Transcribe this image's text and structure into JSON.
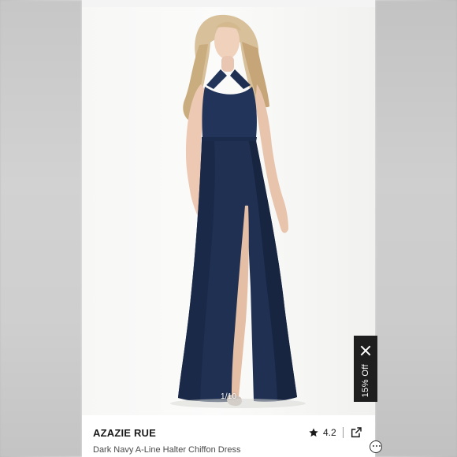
{
  "gallery": {
    "counter": "1/10"
  },
  "promo": {
    "text": "15% Off",
    "close_icon": "close-icon"
  },
  "product": {
    "brand": "AZAZIE RUE",
    "name": "Dark Navy A-Line Halter Chiffon Dress",
    "rating": "4.2",
    "rating_icon": "star-icon",
    "share_icon": "external-link-icon"
  },
  "colors": {
    "dress": "#1f2f52",
    "promo_bg": "#1e1e1e",
    "panel_bg": "#ffffff"
  }
}
